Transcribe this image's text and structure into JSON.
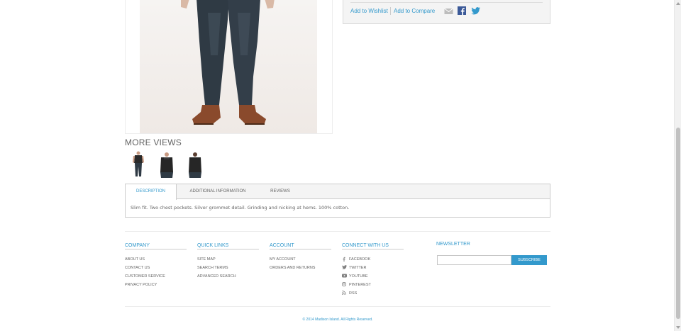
{
  "product": {
    "wishlist_label": "Add to Wishlist",
    "compare_label": "Add to Compare",
    "share_icons": [
      "email-icon",
      "facebook-icon",
      "twitter-icon"
    ]
  },
  "more_views": {
    "title": "MORE VIEWS",
    "thumbnails": [
      "product-view-1",
      "product-view-2",
      "product-view-3"
    ]
  },
  "tabs": {
    "items": [
      {
        "label": "Description"
      },
      {
        "label": "Additional Information"
      },
      {
        "label": "Reviews"
      }
    ],
    "active": 0,
    "description": "Slim fit. Two chest pockets. Silver grommet detail. Grinding and nicking at hems. 100% cotton."
  },
  "footer": {
    "company": {
      "title": "Company",
      "links": [
        "About Us",
        "Contact Us",
        "Customer Service",
        "Privacy Policy"
      ]
    },
    "quick_links": {
      "title": "Quick Links",
      "links": [
        "Site Map",
        "Search Terms",
        "Advanced Search"
      ]
    },
    "account": {
      "title": "Account",
      "links": [
        "My Account",
        "Orders and Returns"
      ]
    },
    "connect": {
      "title": "Connect With Us",
      "links": [
        {
          "label": "Facebook",
          "icon": "facebook-icon"
        },
        {
          "label": "Twitter",
          "icon": "twitter-icon"
        },
        {
          "label": "Youtube",
          "icon": "youtube-icon"
        },
        {
          "label": "Pinterest",
          "icon": "pinterest-icon"
        },
        {
          "label": "RSS",
          "icon": "rss-icon"
        }
      ]
    },
    "newsletter": {
      "title": "Newsletter",
      "placeholder": "",
      "button_label": "Subscribe"
    },
    "copyright": "© 2014 Madison Island. All Rights Reserved."
  },
  "colors": {
    "accent": "#3399cc",
    "text": "#636363",
    "border": "#cccccc"
  }
}
